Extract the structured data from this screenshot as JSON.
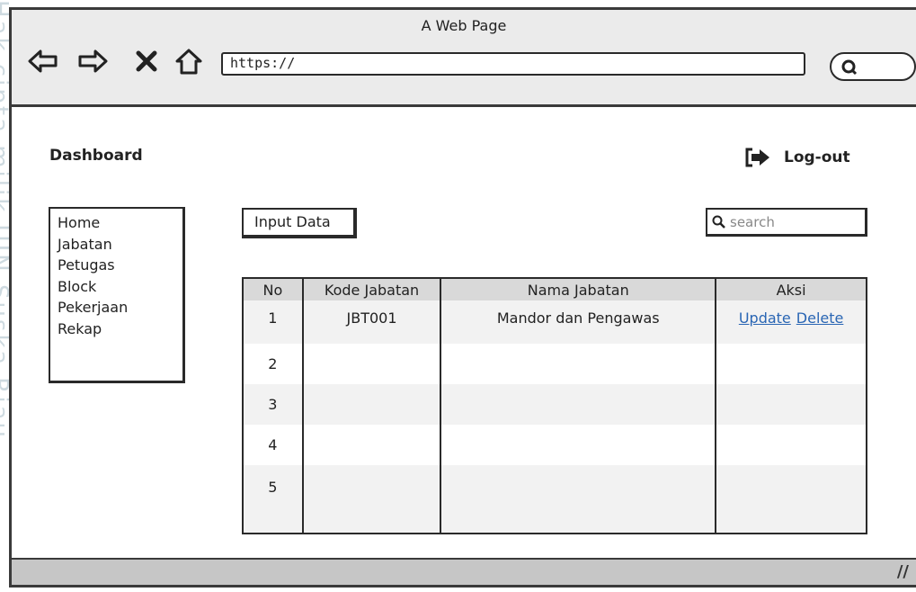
{
  "watermark": "Hak cipta milik UIN Suska Riau",
  "window": {
    "title": "A Web Page"
  },
  "browser": {
    "url": "https://"
  },
  "header": {
    "title": "Dashboard",
    "logout_label": "Log-out"
  },
  "sidebar": {
    "items": [
      {
        "label": "Home"
      },
      {
        "label": "Jabatan"
      },
      {
        "label": "Petugas"
      },
      {
        "label": "Block"
      },
      {
        "label": "Pekerjaan"
      },
      {
        "label": "Rekap"
      }
    ]
  },
  "toolbar": {
    "input_label": "Input Data",
    "search_placeholder": "search"
  },
  "table": {
    "headers": [
      "No",
      "Kode Jabatan",
      "Nama Jabatan",
      "Aksi"
    ],
    "rows": [
      {
        "no": "1",
        "kode": "JBT001",
        "nama": "Mandor dan Pengawas",
        "update": "Update",
        "delete": "Delete"
      },
      {
        "no": "2",
        "kode": "",
        "nama": "",
        "update": "",
        "delete": ""
      },
      {
        "no": "3",
        "kode": "",
        "nama": "",
        "update": "",
        "delete": ""
      },
      {
        "no": "4",
        "kode": "",
        "nama": "",
        "update": "",
        "delete": ""
      },
      {
        "no": "5",
        "kode": "",
        "nama": "",
        "update": "",
        "delete": ""
      }
    ]
  },
  "colors": {
    "link": "#2a66b4",
    "titlebar": "#ebebeb",
    "statusbar": "#c6c6c6",
    "header_row": "#d9d9d9"
  }
}
